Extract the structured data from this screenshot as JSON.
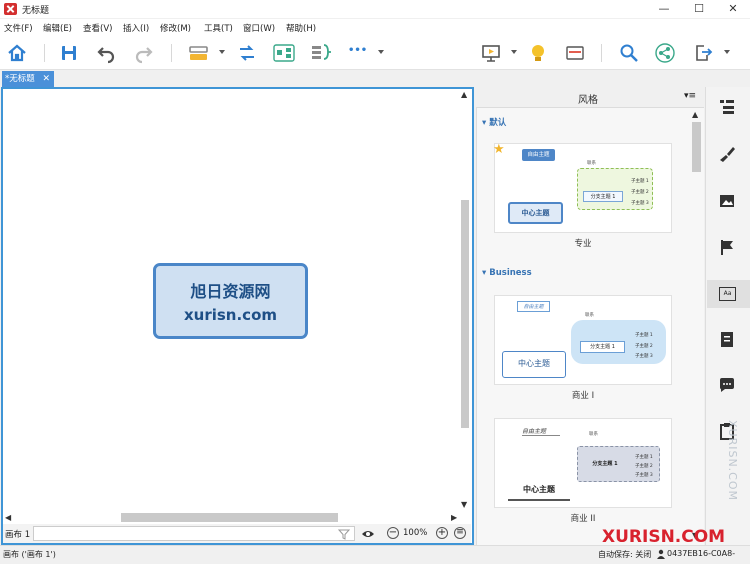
{
  "window": {
    "title": "无标题",
    "minimize": "—",
    "maximize": "☐",
    "close": "✕"
  },
  "menu": [
    "文件(F)",
    "编辑(E)",
    "查看(V)",
    "插入(I)",
    "修改(M)",
    "工具(T)",
    "窗口(W)",
    "帮助(H)"
  ],
  "toolbar": {
    "more_label": "•••"
  },
  "tab": {
    "label": "*无标题",
    "close": "✕"
  },
  "canvas": {
    "central_topic_line1": "旭日资源网",
    "central_topic_line2": "xurisn.com"
  },
  "canvas_status": {
    "sheet_label": "画布 1",
    "zoom": "100%"
  },
  "panel": {
    "title": "风格",
    "sections": [
      {
        "name": "默认",
        "styles": [
          {
            "caption": "专业",
            "central": "中心主题",
            "branch": "分支主题 1",
            "floating": "自由主题",
            "note": "联系",
            "subs": [
              "子主题 1",
              "子主题 2",
              "子主题 3"
            ]
          }
        ]
      },
      {
        "name": "Business",
        "styles": [
          {
            "caption": "商业 I",
            "central": "中心主题",
            "branch": "分支主题 1",
            "floating": "自由主题",
            "note": "联系",
            "subs": [
              "子主题 1",
              "子主题 2",
              "子主题 3"
            ]
          },
          {
            "caption": "商业 II",
            "central": "中心主题",
            "branch": "分支主题 1",
            "floating": "自由主题",
            "note": "联系",
            "subs": [
              "子主题 1",
              "子主题 2",
              "子主题 3"
            ]
          }
        ]
      }
    ]
  },
  "statusbar": {
    "left": "画布 ('画布 1')",
    "autosave": "自动保存: 关闭",
    "id": "0437EB16-C0A8-"
  },
  "watermark": {
    "overlay": "XURISN.COM",
    "side": "XURISN.COM"
  },
  "colors": {
    "accent": "#3f95d6",
    "central_fill": "#cfe0f2",
    "central_border": "#4a86c8",
    "tab": "#4a90d9"
  }
}
